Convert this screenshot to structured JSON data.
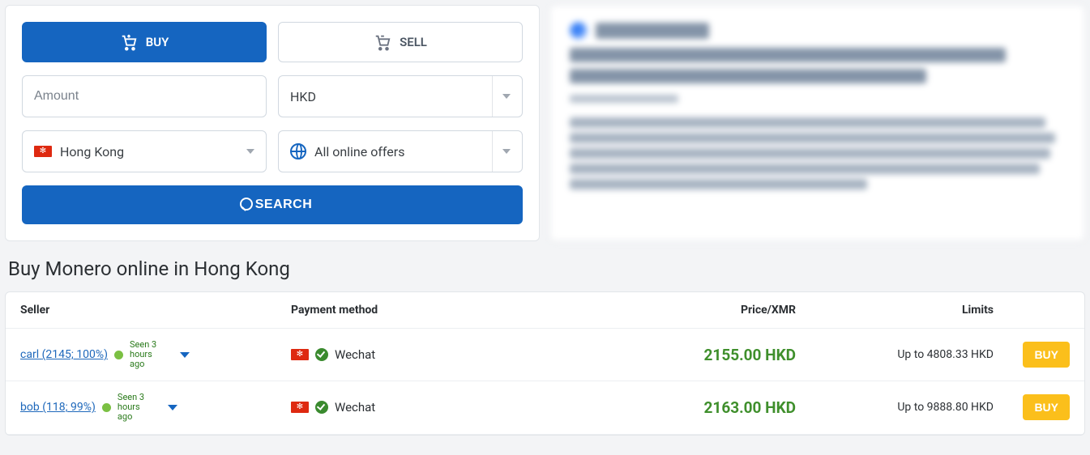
{
  "tabs": {
    "buy": "BUY",
    "sell": "SELL"
  },
  "search": {
    "amount_placeholder": "Amount",
    "currency": "HKD",
    "country": "Hong Kong",
    "payment_filter": "All online offers",
    "button": "SEARCH"
  },
  "section_title": "Buy Monero online in Hong Kong",
  "columns": {
    "seller": "Seller",
    "payment": "Payment method",
    "price": "Price/XMR",
    "limits": "Limits"
  },
  "listings": [
    {
      "seller_name": "carl",
      "seller_stats": "(2145; 100%)",
      "seen": "Seen 3 hours ago",
      "payment_method": "Wechat",
      "price": "2155.00 HKD",
      "limits": "Up to 4808.33 HKD",
      "action": "BUY"
    },
    {
      "seller_name": "bob",
      "seller_stats": "(118; 99%)",
      "seen": "Seen 3 hours ago",
      "payment_method": "Wechat",
      "price": "2163.00 HKD",
      "limits": "Up to 9888.80 HKD",
      "action": "BUY"
    }
  ]
}
